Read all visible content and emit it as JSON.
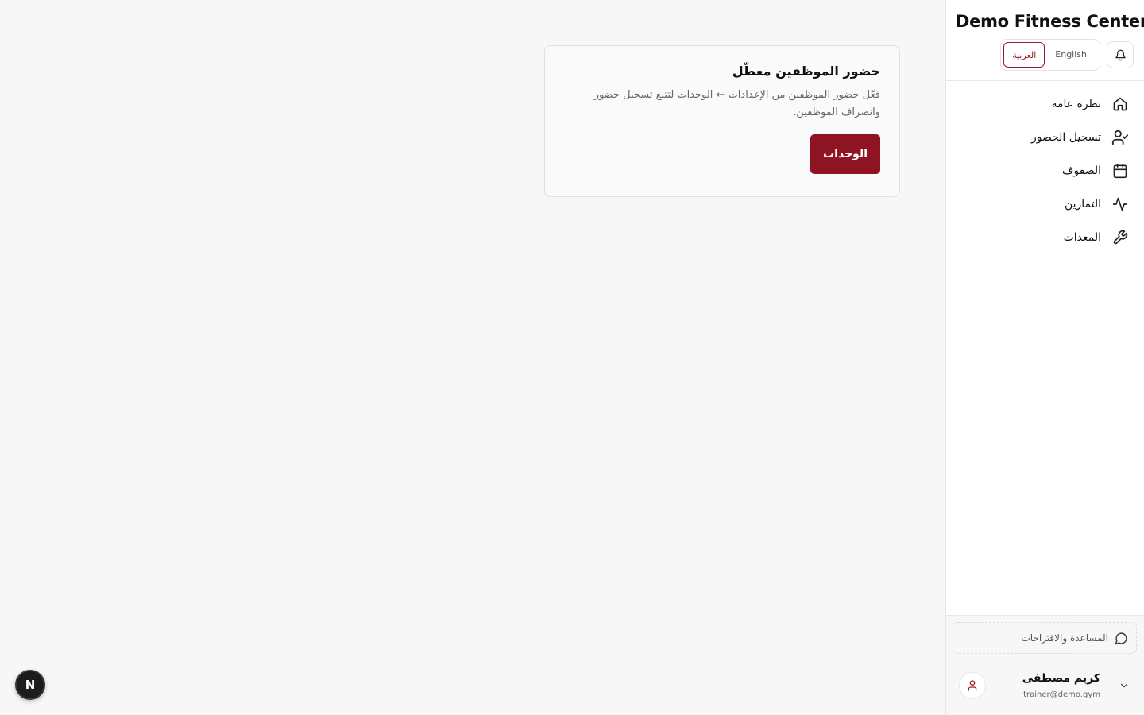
{
  "brand": {
    "name": "Demo Fitness Center"
  },
  "language": {
    "english_label": "English",
    "arabic_label": "العربية",
    "active": "ar"
  },
  "nav": {
    "items": [
      {
        "label": "نظرة عامة",
        "icon": "home-icon"
      },
      {
        "label": "تسجيل الحضور",
        "icon": "user-check-icon"
      },
      {
        "label": "الصفوف",
        "icon": "calendar-icon"
      },
      {
        "label": "التمارين",
        "icon": "activity-icon"
      },
      {
        "label": "المعدات",
        "icon": "wrench-icon"
      }
    ]
  },
  "footer": {
    "help_label": "المساعدة والاقتراحات",
    "user": {
      "name": "كريم مصطفى",
      "email": "trainer@demo.gym"
    }
  },
  "card": {
    "title": "حضور الموظفين معطّل",
    "description": "فعّل حضور الموظفين من الإعدادات ← الوحدات لتتبع تسجيل حضور وانصراف الموظفين.",
    "button_label": "الوحدات"
  },
  "badge": {
    "label": "N"
  },
  "colors": {
    "accent": "#8e1424",
    "background": "#f7f7f7",
    "sidebar": "#ffffff"
  }
}
